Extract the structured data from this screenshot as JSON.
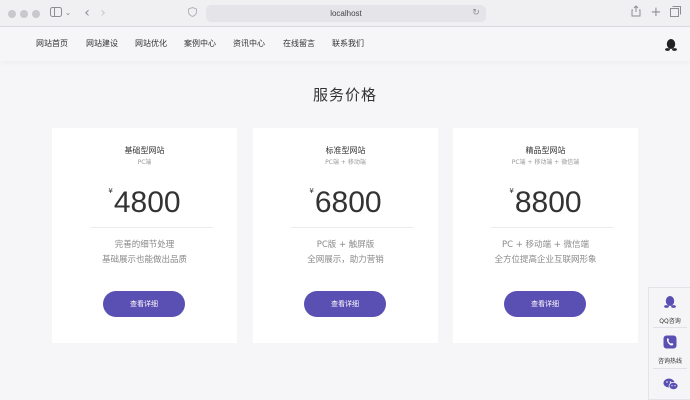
{
  "browser": {
    "url": "localhost",
    "icons": [
      "traffic-light-icon",
      "sidebar-icon",
      "chevron-down-icon",
      "back-icon",
      "forward-icon",
      "privacy-icon",
      "reload-icon",
      "share-icon",
      "new-tab-icon",
      "tabs-overview-icon"
    ]
  },
  "nav": {
    "items": [
      "网站首页",
      "网站建设",
      "网站优化",
      "案例中心",
      "资讯中心",
      "在线留言",
      "联系我们"
    ]
  },
  "section": {
    "title": "服务价格"
  },
  "cards": [
    {
      "name": "基础型网站",
      "sub": "PC端",
      "currency": "¥",
      "price": "4800",
      "desc1": "完善的细节处理",
      "desc2": "基础展示也能做出品质",
      "button": "查看详细"
    },
    {
      "name": "标准型网站",
      "sub": "PC端 + 移动端",
      "currency": "¥",
      "price": "6800",
      "desc1": "PC版 + 触屏版",
      "desc2": "全网展示，助力营销",
      "button": "查看详细"
    },
    {
      "name": "精品型网站",
      "sub": "PC端 + 移动端 + 微信端",
      "currency": "¥",
      "price": "8800",
      "desc1": "PC + 移动端 + 微信端",
      "desc2": "全方位提高企业互联网形象",
      "button": "查看详细"
    }
  ],
  "side": {
    "qq": "QQ咨询",
    "phone": "咨询热线"
  },
  "colors": {
    "accent": "#5a4fb3",
    "background": "#f6f6f8"
  }
}
